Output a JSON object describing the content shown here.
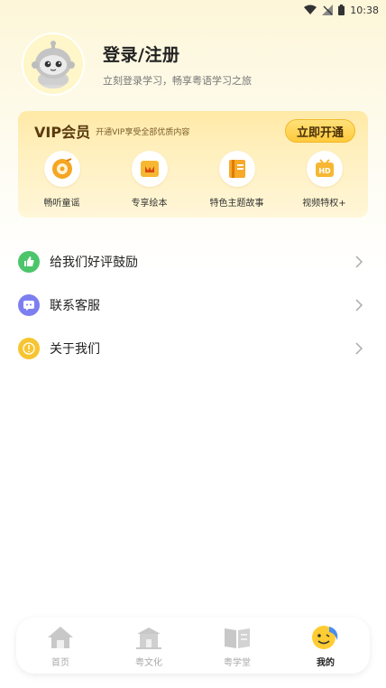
{
  "status_bar": {
    "time": "10:38",
    "icons": [
      "wifi-icon",
      "signal-icon",
      "battery-icon"
    ]
  },
  "profile": {
    "title": "登录/注册",
    "subtitle": "立刻登录学习，畅享粤语学习之旅",
    "avatar": "robot-mascot-avatar"
  },
  "vip": {
    "title": "VIP会员",
    "description": "开通VIP享受全部优质内容",
    "button_label": "立即开通",
    "features": [
      {
        "label": "畅听童谣",
        "icon": "vinyl-record-icon"
      },
      {
        "label": "专享绘本",
        "icon": "picture-book-icon"
      },
      {
        "label": "特色主题故事",
        "icon": "story-book-icon"
      },
      {
        "label": "视频特权+",
        "icon": "hd-video-icon"
      }
    ]
  },
  "menu": [
    {
      "label": "给我们好评鼓励",
      "icon": "thumbs-up-icon",
      "color": "#4cc56b"
    },
    {
      "label": "联系客服",
      "icon": "chat-icon",
      "color": "#7d7ff0"
    },
    {
      "label": "关于我们",
      "icon": "info-icon",
      "color": "#f7c531"
    }
  ],
  "tabbar": {
    "tabs": [
      {
        "label": "首页",
        "icon": "home-icon"
      },
      {
        "label": "粤文化",
        "icon": "temple-icon"
      },
      {
        "label": "粤学堂",
        "icon": "book-icon"
      },
      {
        "label": "我的",
        "icon": "smiley-icon",
        "active": true
      }
    ]
  },
  "colors": {
    "accent": "#ffca3a",
    "vip_text": "#5a3a0e",
    "inactive_tab": "#aaaaaa"
  }
}
